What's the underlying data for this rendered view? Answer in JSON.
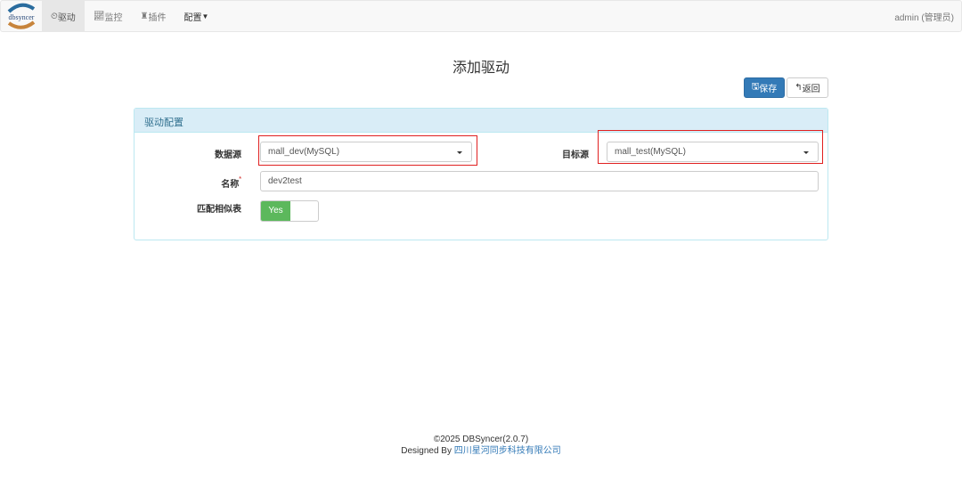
{
  "nav": {
    "logo_text": "dbsyncer",
    "items": [
      {
        "label": "驱动",
        "icon": "dashboard-icon",
        "active": true
      },
      {
        "label": "监控",
        "icon": "line-chart-icon"
      },
      {
        "label": "插件",
        "icon": "plugin-icon"
      },
      {
        "label": "配置",
        "icon": "caret-down-icon"
      }
    ],
    "user": "admin (管理员)"
  },
  "page": {
    "title": "添加驱动",
    "save_label": "保存",
    "back_label": "返回"
  },
  "panel": {
    "heading": "驱动配置",
    "source_label": "数据源",
    "source_value": "mall_dev(MySQL)",
    "target_label": "目标源",
    "target_value": "mall_test(MySQL)",
    "name_label": "名称",
    "required_mark": "*",
    "name_value": "dev2test",
    "match_label": "匹配相似表",
    "toggle_label": "Yes"
  },
  "footer": {
    "copyright": "©2025 DBSyncer(2.0.7)",
    "designed_by": "Designed By",
    "company": "四川星河同步科技有限公司"
  },
  "colors": {
    "primary": "#337ab7",
    "success": "#5cb85c",
    "highlight": "#e02020"
  }
}
